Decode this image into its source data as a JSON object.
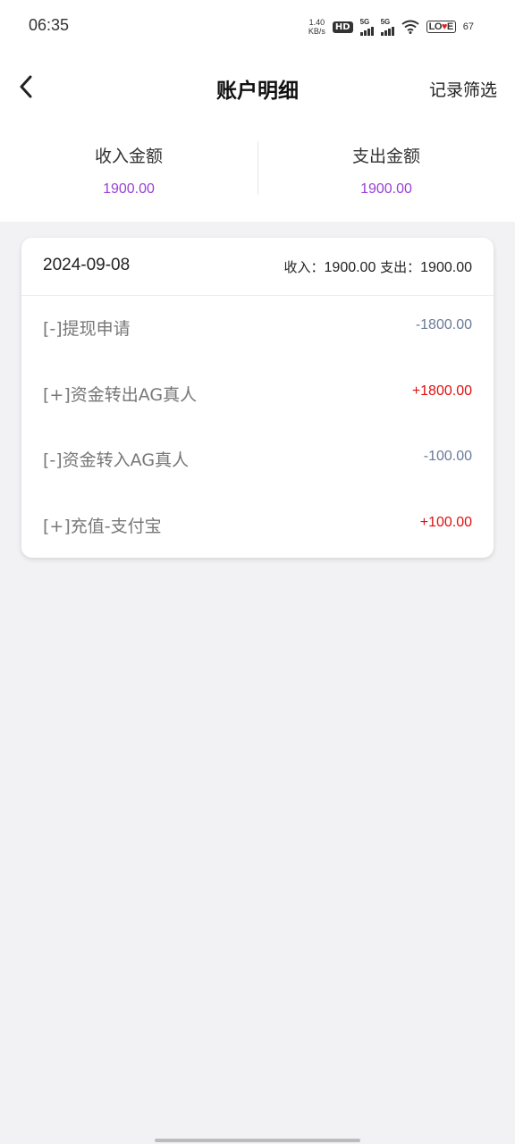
{
  "status_bar": {
    "time": "06:35",
    "net_speed_value": "1.40",
    "net_speed_unit": "KB/s",
    "hd_label": "HD",
    "sim1_label": "5G",
    "sim2_label": "5G",
    "battery_text_a": "LO",
    "battery_text_b": "E",
    "battery_level": "67"
  },
  "header": {
    "title": "账户明细",
    "filter_label": "记录筛选"
  },
  "summary": {
    "income_label": "收入金额",
    "income_value": "1900.00",
    "expense_label": "支出金额",
    "expense_value": "1900.00"
  },
  "day_group": {
    "date": "2024-09-08",
    "income_label": "收入：",
    "income_value": "1900.00",
    "expense_label": "支出：",
    "expense_value": "1900.00",
    "records": [
      {
        "label": "[-]提现申请",
        "amount": "-1800.00",
        "sign": "neg"
      },
      {
        "label": "[+]资金转出AG真人",
        "amount": "+1800.00",
        "sign": "pos"
      },
      {
        "label": "[-]资金转入AG真人",
        "amount": "-100.00",
        "sign": "neg"
      },
      {
        "label": "[+]充值-支付宝",
        "amount": "+100.00",
        "sign": "pos"
      }
    ]
  },
  "colors": {
    "income_purple": "#9a3fd6",
    "positive_red": "#e01010",
    "negative_slate": "#6a7a96"
  }
}
